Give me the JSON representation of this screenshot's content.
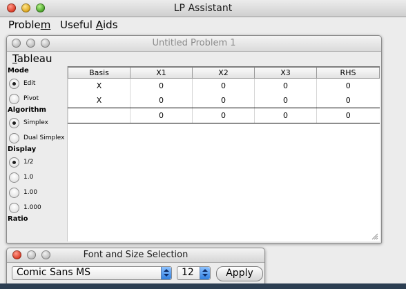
{
  "app": {
    "title": "LP Assistant",
    "menu": [
      {
        "label": "Problem",
        "mnemonic": "m"
      },
      {
        "label": "Useful Aids",
        "mnemonic": "A"
      }
    ]
  },
  "problem_window": {
    "title": "Untitled Problem 1",
    "menu_label": "Tableau",
    "sidebar": {
      "mode_label": "Mode",
      "mode_options": [
        {
          "label": "Edit",
          "selected": true
        },
        {
          "label": "Pivot",
          "selected": false
        }
      ],
      "algorithm_label": "Algorithm",
      "algorithm_options": [
        {
          "label": "Simplex",
          "selected": true
        },
        {
          "label": "Dual Simplex",
          "selected": false
        }
      ],
      "display_label": "Display",
      "display_options": [
        {
          "label": "1/2",
          "selected": true
        },
        {
          "label": "1.0",
          "selected": false
        },
        {
          "label": "1.00",
          "selected": false
        },
        {
          "label": "1.000",
          "selected": false
        }
      ],
      "ratio_label": "Ratio"
    },
    "tableau": {
      "columns": [
        "Basis",
        "X1",
        "X2",
        "X3",
        "RHS"
      ],
      "rows": [
        [
          "X",
          "0",
          "0",
          "0",
          "0"
        ],
        [
          "X",
          "0",
          "0",
          "0",
          "0"
        ]
      ],
      "objective_row": [
        "",
        "0",
        "0",
        "0",
        "0"
      ]
    }
  },
  "font_window": {
    "title": "Font and Size Selection",
    "font_value": "Comic Sans MS",
    "size_value": "12",
    "apply_label": "Apply"
  }
}
